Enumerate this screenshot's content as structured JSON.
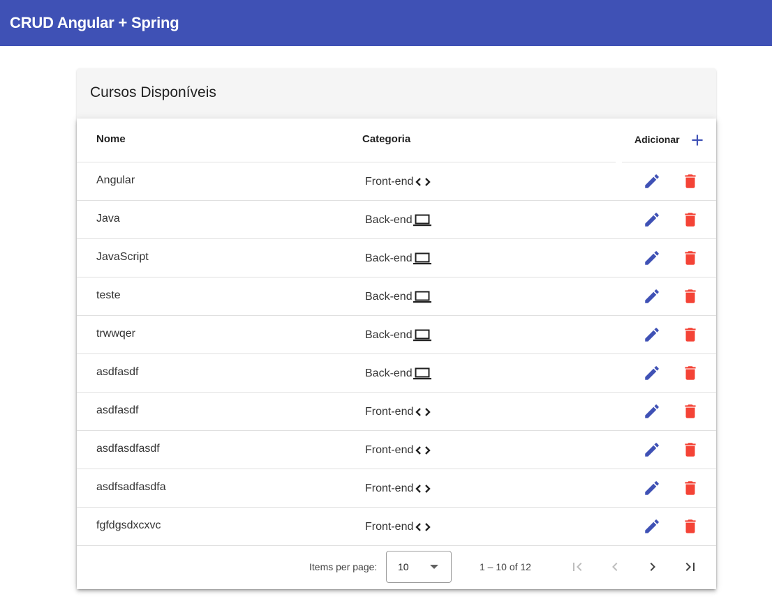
{
  "app": {
    "title": "CRUD Angular + Spring"
  },
  "card": {
    "title": "Cursos Disponíveis"
  },
  "table": {
    "headers": {
      "nome": "Nome",
      "categoria": "Categoria",
      "adicionar": "Adicionar"
    },
    "rows": [
      {
        "nome": "Angular",
        "categoria": "Front-end",
        "icon": "code-icon"
      },
      {
        "nome": "Java",
        "categoria": "Back-end",
        "icon": "laptop-icon"
      },
      {
        "nome": "JavaScript",
        "categoria": "Back-end",
        "icon": "laptop-icon"
      },
      {
        "nome": "teste",
        "categoria": "Back-end",
        "icon": "laptop-icon"
      },
      {
        "nome": "trwwqer",
        "categoria": "Back-end",
        "icon": "laptop-icon"
      },
      {
        "nome": "asdfasdf",
        "categoria": "Back-end",
        "icon": "laptop-icon"
      },
      {
        "nome": "asdfasdf",
        "categoria": "Front-end",
        "icon": "code-icon"
      },
      {
        "nome": "asdfasdfasdf",
        "categoria": "Front-end",
        "icon": "code-icon"
      },
      {
        "nome": "asdfsadfasdfa",
        "categoria": "Front-end",
        "icon": "code-icon"
      },
      {
        "nome": "fgfdgsdxcxvc",
        "categoria": "Front-end",
        "icon": "code-icon"
      }
    ]
  },
  "paginator": {
    "items_per_page_label": "Items per page:",
    "page_size": "10",
    "range_label": "1 – 10 of 12"
  },
  "colors": {
    "primary": "#3f51b5",
    "warn": "#f44336"
  }
}
